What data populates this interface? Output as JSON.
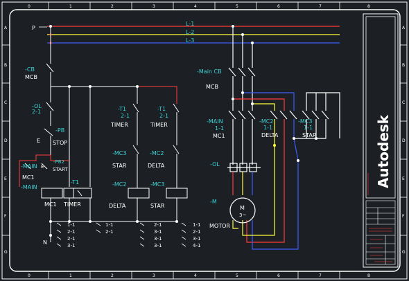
{
  "drawing": {
    "left_bus_label": "P",
    "neutral_label": "N",
    "lines": [
      "L-1",
      "L-2",
      "L-3"
    ],
    "colors": {
      "background": "#1c2024",
      "l1": "#ff3b3b",
      "l2": "#ffff3b",
      "l3": "#3b5cff",
      "wire": "#ffffff",
      "label_cyan": "#39d3d6",
      "control_red": "#ff3b3b"
    },
    "border_numbers_top": [
      "0",
      "1",
      "2",
      "3",
      "4",
      "5",
      "6",
      "7",
      "8"
    ],
    "border_numbers_bottom": [
      "0",
      "1",
      "2",
      "3",
      "4",
      "5",
      "6",
      "7",
      "8"
    ],
    "border_letters_left": [
      "A",
      "B",
      "C",
      "D",
      "E",
      "F",
      "G"
    ],
    "border_letters_right": [
      "A",
      "B",
      "C",
      "D",
      "E",
      "F",
      "G"
    ]
  },
  "control": {
    "mcb_tag": "-CB",
    "mcb_label": "MCB",
    "ol_tag": "-OL",
    "ol_sub": "2-1",
    "pb_tag": "-PB",
    "stop_letter": "E",
    "stop_label": "STOP",
    "pb2_tag": "-PB2",
    "start_letter": "E",
    "start_label": "START",
    "main_tag_a": "-MAIN",
    "main_sub_a": "MC1",
    "main_tag_b": "-MAIN",
    "mc1_label": "MC1",
    "t1_tag": "-T1",
    "timer_label": "TIMER",
    "t1a_tag": "-T1",
    "t1a_sub": "2-1",
    "timer_a_label": "TIMER",
    "t1b_tag": "-T1",
    "t1b_sub": "2-1",
    "timer_b_label": "TIMER",
    "mc3a_tag": "-MC3",
    "star_a_label": "STAR",
    "mc2a_tag": "-MC2",
    "delta_a_label": "DELTA",
    "mc2b_tag": "-MC2",
    "delta_b_label": "DELTA",
    "mc3b_tag": "-MC3",
    "star_b_label": "STAR",
    "xref_col1": [
      "1-1",
      "2-1",
      "2-1",
      "3-1"
    ],
    "xref_col2": [
      "1-1",
      "2-1"
    ],
    "xref_col3": [
      "2-1",
      "3-1",
      "3-1",
      "3-1"
    ],
    "xref_col4": [
      "1-1",
      "2-1",
      "3-1",
      "4-1"
    ]
  },
  "power": {
    "main_cb_tag": "-Main CB",
    "mcb_label": "MCB",
    "main_tag": "-MAIN",
    "main_sub": "1-1",
    "mc1_label": "MC1",
    "mc2_tag": "-MC2",
    "mc2_sub": "1-1",
    "delta_label": "DELTA",
    "mc3_tag": "-MC3",
    "mc3_sub": "1-1",
    "star_label": "STAR",
    "ol_tag": "-OL",
    "m_tag": "-M",
    "motor_symbol": "M",
    "motor_phase": "3~",
    "motor_label": "MOTOR"
  },
  "title_block": {
    "brand": "Autodesk"
  }
}
